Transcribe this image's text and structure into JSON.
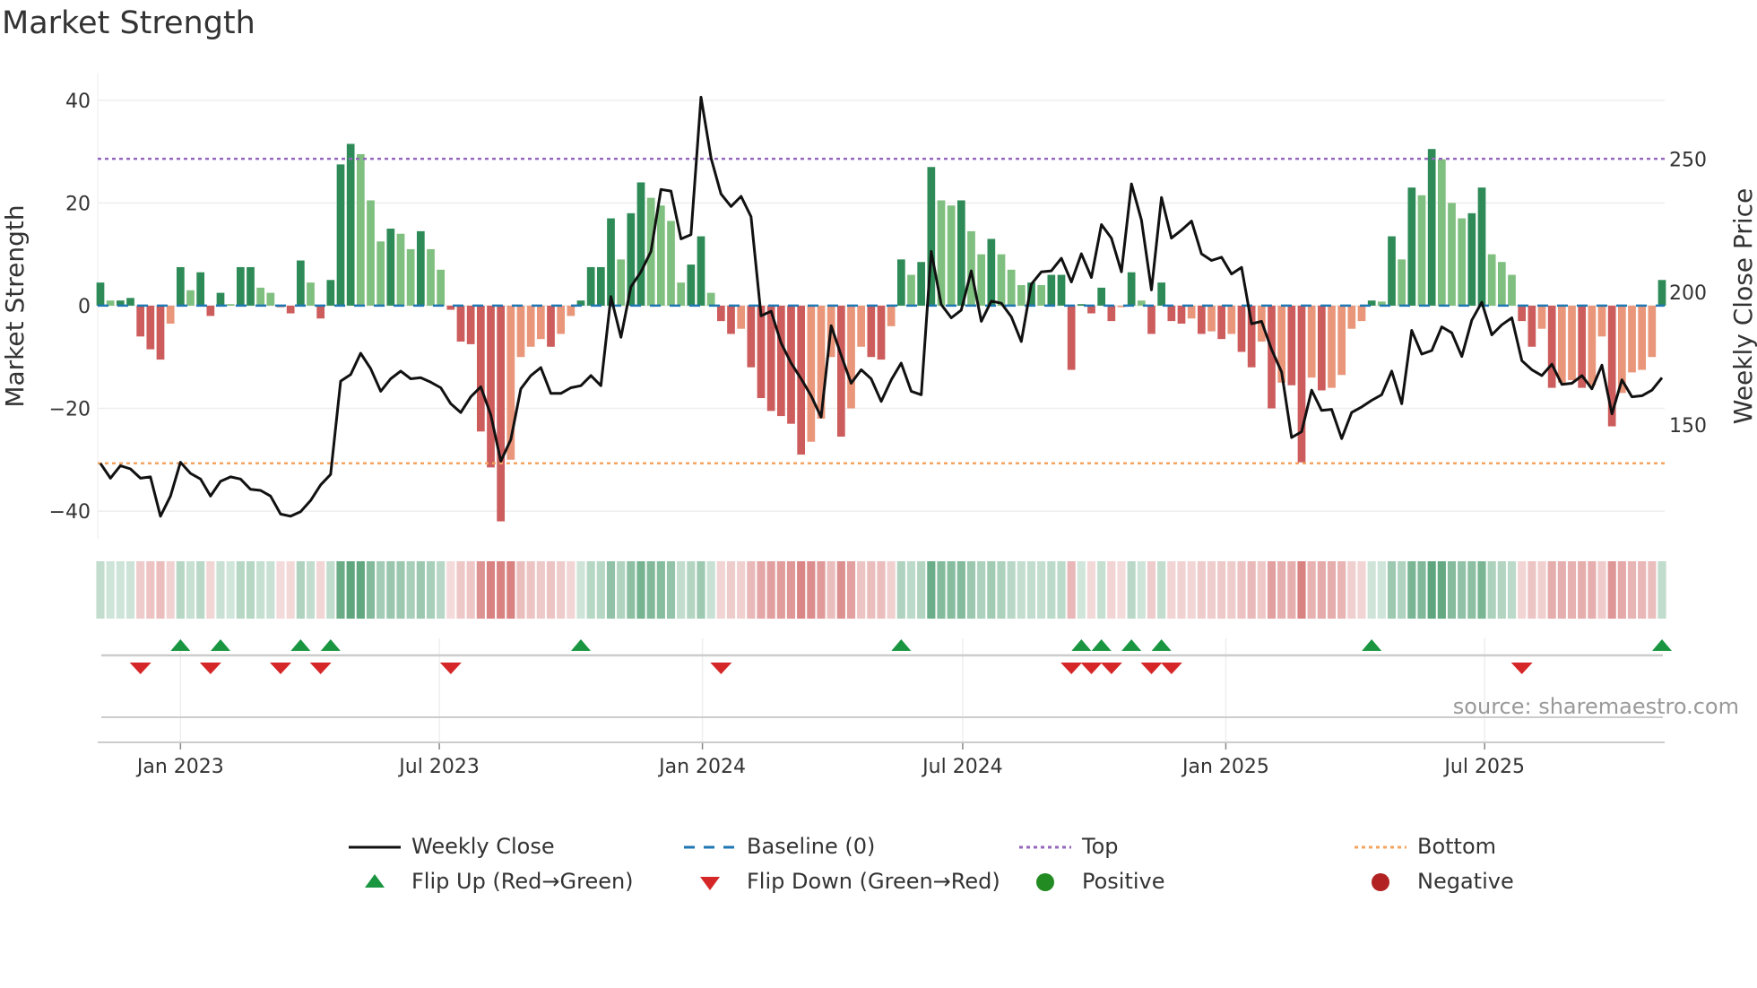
{
  "title": "Market Strength",
  "source": "source: sharemaestro.com",
  "colors": {
    "pos_strong": "#2e8b57",
    "pos_weak": "#7fbf7f",
    "neg_strong": "#cd5c5c",
    "neg_weak": "#e9967a",
    "close_line": "#111111",
    "baseline": "#1f77b4",
    "top": "#9467bd",
    "bottom": "#f4a460",
    "flip_up": "#1a9641",
    "flip_down": "#d62728",
    "positive_dot": "#228b22",
    "negative_dot": "#b22222"
  },
  "chart_data": {
    "type": "bar",
    "title": "Market Strength",
    "ylabel": "Market Strength",
    "y2label": "Weekly Close Price",
    "ylim": [
      -45.4,
      45.2
    ],
    "y2lim": [
      107.2,
      282.2
    ],
    "yticks": [
      40,
      20,
      0,
      -20,
      -40
    ],
    "ytick_labels": [
      "40",
      "20",
      "0",
      "−20",
      "−40"
    ],
    "y2ticks": [
      250,
      200,
      150
    ],
    "y2tick_labels": [
      "250",
      "200",
      "150"
    ],
    "start_date": "2022-11-06",
    "frequency": "weekly",
    "xticks": [
      {
        "date": "2023-01-01",
        "label": "Jan 2023"
      },
      {
        "date": "2023-07-01",
        "label": "Jul 2023"
      },
      {
        "date": "2024-01-01",
        "label": "Jan 2024"
      },
      {
        "date": "2024-07-01",
        "label": "Jul 2024"
      },
      {
        "date": "2025-01-01",
        "label": "Jan 2025"
      },
      {
        "date": "2025-07-01",
        "label": "Jul 2025"
      }
    ],
    "top_level": 28.6,
    "bottom_level": -30.7,
    "baseline": 0,
    "strength": [
      4.5,
      1,
      1,
      1.5,
      -6,
      -8.5,
      -10.5,
      -3.5,
      7.5,
      3,
      6.5,
      -2,
      2.5,
      0.3,
      7.5,
      7.5,
      3.5,
      2.5,
      -0.3,
      -1.5,
      8.8,
      4.5,
      -2.5,
      5,
      27.5,
      31.5,
      29.5,
      20.5,
      12.5,
      15,
      14,
      11,
      14.5,
      11,
      7,
      -0.8,
      -7,
      -7.5,
      -24.5,
      -31.5,
      -42,
      -30,
      -10,
      -8,
      -6.5,
      -8,
      -5.5,
      -2,
      1,
      7.5,
      7.5,
      17,
      9,
      18,
      24,
      21,
      19.5,
      16.5,
      4.5,
      8,
      13.5,
      2.5,
      -3,
      -5.5,
      -4.5,
      -12,
      -18,
      -20.5,
      -21.5,
      -23,
      -29,
      -26.5,
      -22,
      -10,
      -25.5,
      -20,
      -8,
      -10,
      -10.5,
      -4,
      9,
      6,
      8.5,
      27,
      20.5,
      19.5,
      20.5,
      14.5,
      10,
      13,
      10,
      7,
      4,
      4.5,
      4,
      6,
      6,
      -12.5,
      0.3,
      -1.5,
      3.5,
      -3,
      -0.3,
      6.5,
      1,
      -5.5,
      4.5,
      -3,
      -3.5,
      -2.5,
      -5.5,
      -5,
      -6.5,
      -5.5,
      -9,
      -12,
      -7,
      -20,
      -15,
      -15.5,
      -30.5,
      -14,
      -16.5,
      -16,
      -13.5,
      -4.5,
      -3,
      1,
      0.8,
      13.5,
      9,
      23,
      21.5,
      30.5,
      28.5,
      20,
      17,
      18,
      23,
      10,
      8.5,
      6,
      -3,
      -8,
      -4.5,
      -16,
      -15,
      -14.5,
      -16,
      -15.5,
      -6,
      -23.5,
      -17,
      -13,
      -12.5,
      -10,
      5
    ],
    "weekly_close": [
      135.6,
      130,
      134.7,
      133.5,
      130,
      130.5,
      115.7,
      123.3,
      136,
      131.8,
      129.7,
      123.3,
      128.8,
      130.5,
      129.7,
      125.8,
      125.4,
      123.3,
      116.5,
      115.7,
      117.4,
      121.6,
      127.5,
      131.4,
      166.5,
      169,
      177,
      171.2,
      162.7,
      167.4,
      170.3,
      167.4,
      167.8,
      166.1,
      164,
      158,
      154.7,
      160.6,
      164.4,
      153.8,
      136.4,
      144.5,
      163.6,
      168.6,
      171.6,
      161.9,
      161.9,
      164,
      164.8,
      168.6,
      164.8,
      198.3,
      183,
      202,
      207.6,
      215.3,
      238.6,
      238,
      220,
      221.6,
      273.3,
      250.4,
      236.9,
      232.2,
      236,
      228.4,
      191.1,
      192.8,
      180.9,
      173.3,
      167.4,
      161,
      153,
      187.3,
      176.3,
      165.7,
      170.8,
      167.4,
      158.9,
      167,
      173.3,
      162.7,
      161.4,
      215.3,
      195.3,
      190.3,
      193.2,
      208,
      189,
      196.6,
      195.8,
      190.7,
      181.4,
      203,
      207.6,
      208,
      212.7,
      203.8,
      214.4,
      205.5,
      225.4,
      220.3,
      207.6,
      240.7,
      227.1,
      200.8,
      235.6,
      220.3,
      223.3,
      226.7,
      214.4,
      211.9,
      213.1,
      206.8,
      209.3,
      188.1,
      189,
      178.4,
      169.9,
      145.3,
      147.5,
      163.1,
      155.5,
      155.9,
      144.9,
      154.7,
      156.8,
      159.3,
      161.4,
      170.3,
      158,
      185.6,
      176.7,
      178,
      186.9,
      184.7,
      175.8,
      189.4,
      196.2,
      183.9,
      187.7,
      190.3,
      174.2,
      170.8,
      168.6,
      172.9,
      165.3,
      165.7,
      168.6,
      163.6,
      172.5,
      154.2,
      167,
      160.6,
      161,
      163.1,
      167.8
    ],
    "legend": [
      {
        "key": "close",
        "label": "Weekly Close"
      },
      {
        "key": "baseline",
        "label": "Baseline (0)"
      },
      {
        "key": "top",
        "label": "Top"
      },
      {
        "key": "bottom",
        "label": "Bottom"
      },
      {
        "key": "flip_up",
        "label": "Flip Up (Red→Green)"
      },
      {
        "key": "flip_down",
        "label": "Flip Down (Green→Red)"
      },
      {
        "key": "positive",
        "label": "Positive"
      },
      {
        "key": "negative",
        "label": "Negative"
      }
    ],
    "legend_position": "bottom"
  }
}
